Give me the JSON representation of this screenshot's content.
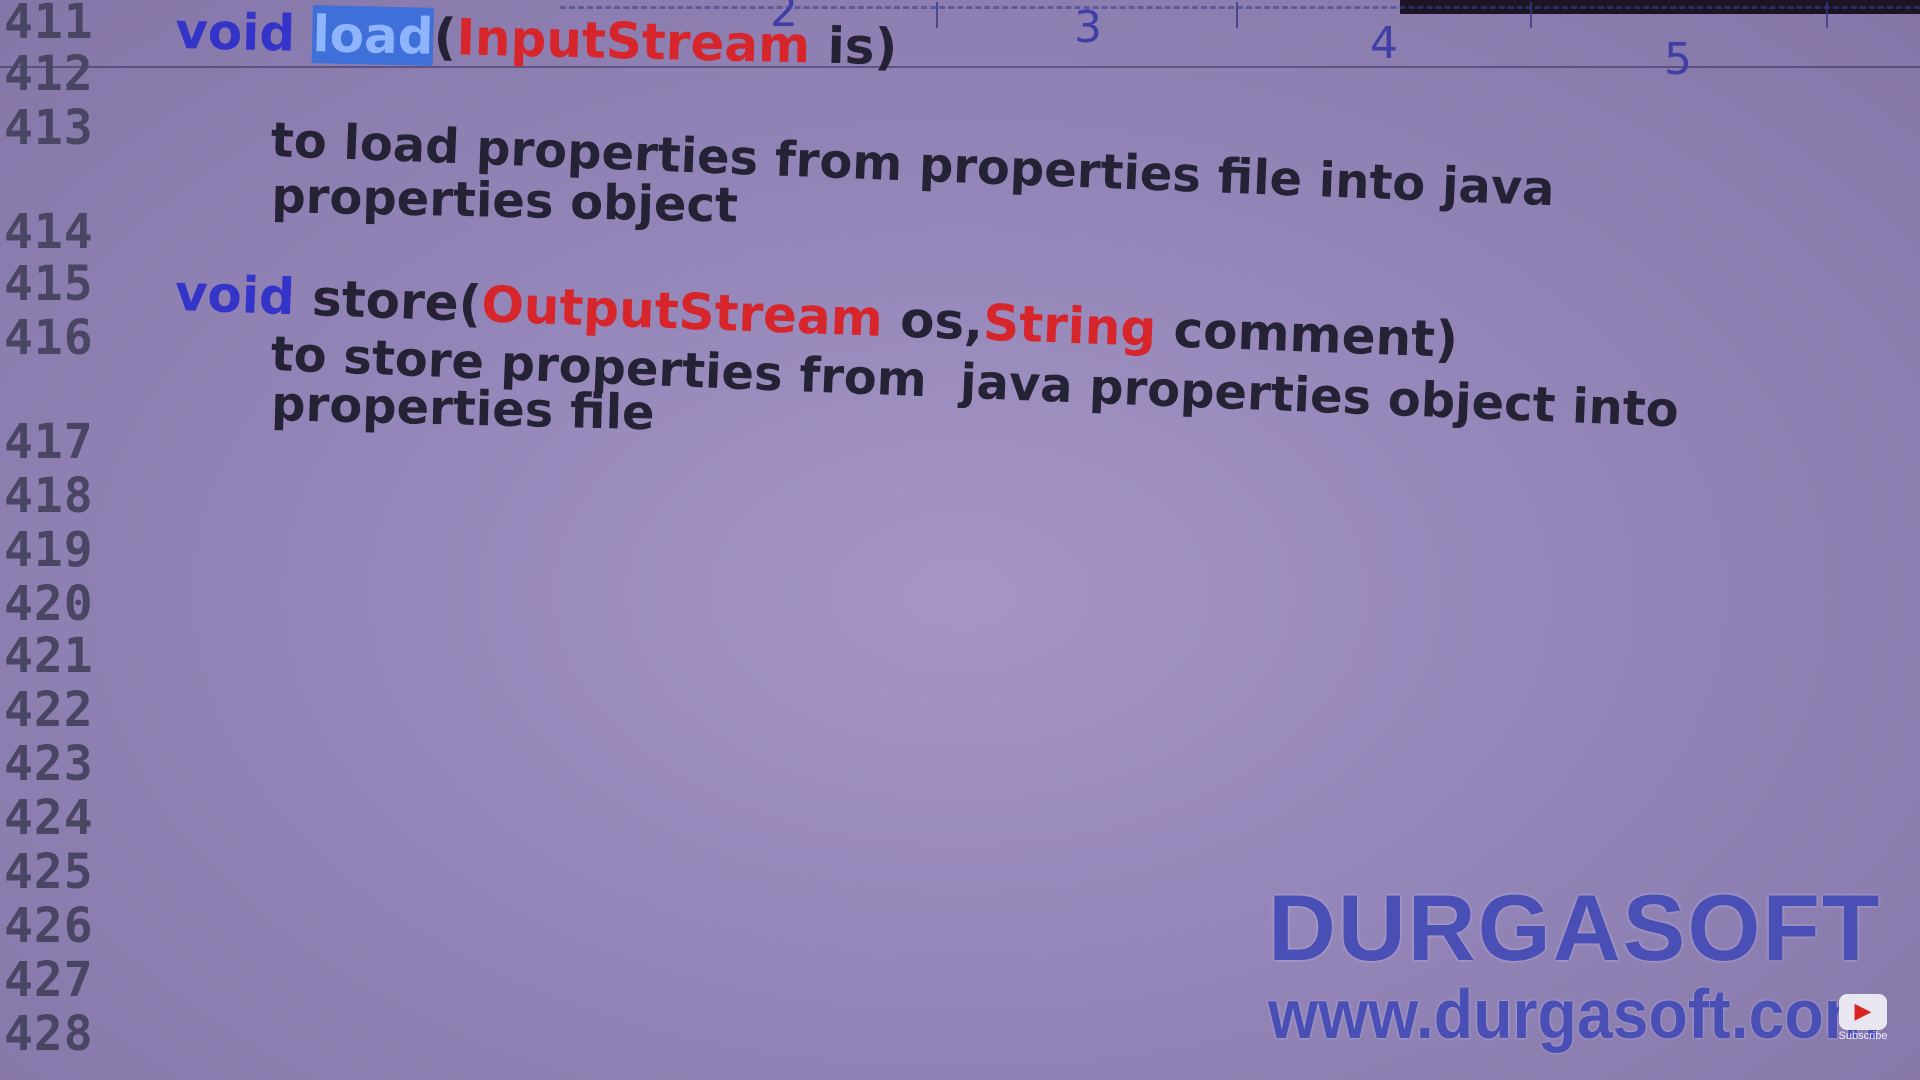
{
  "ruler": {
    "labels": [
      "2",
      "3",
      "4",
      "5"
    ]
  },
  "line_numbers": [
    "411",
    "412",
    "413",
    "414",
    "415",
    "416",
    "417",
    "418",
    "419",
    "420",
    "421",
    "422",
    "423",
    "424",
    "425",
    "426",
    "427",
    "428"
  ],
  "code": {
    "load_sig": {
      "keyword": "void",
      "method": "load",
      "open": "(",
      "param_type": "InputStream",
      "param_rest": " is)"
    },
    "load_desc": [
      "to load properties from properties file into java",
      "properties object"
    ],
    "store_sig": {
      "keyword": "void",
      "method": " store(",
      "param_type1": "OutputStream",
      "sep": " os,",
      "param_type2": "String",
      "param_rest": " comment)"
    },
    "store_desc": [
      "to store properties from  java properties object into",
      "properties file"
    ]
  },
  "watermark": {
    "name": "DURGASOFT",
    "url": "www.durgasoft.com"
  },
  "subscribe": {
    "label": "Subscribe",
    "icon": "play-icon"
  },
  "colors": {
    "keyword": "#3434c8",
    "type": "#d6262c",
    "selection": "#3f6fd8",
    "brand": "#4a4fb6"
  }
}
